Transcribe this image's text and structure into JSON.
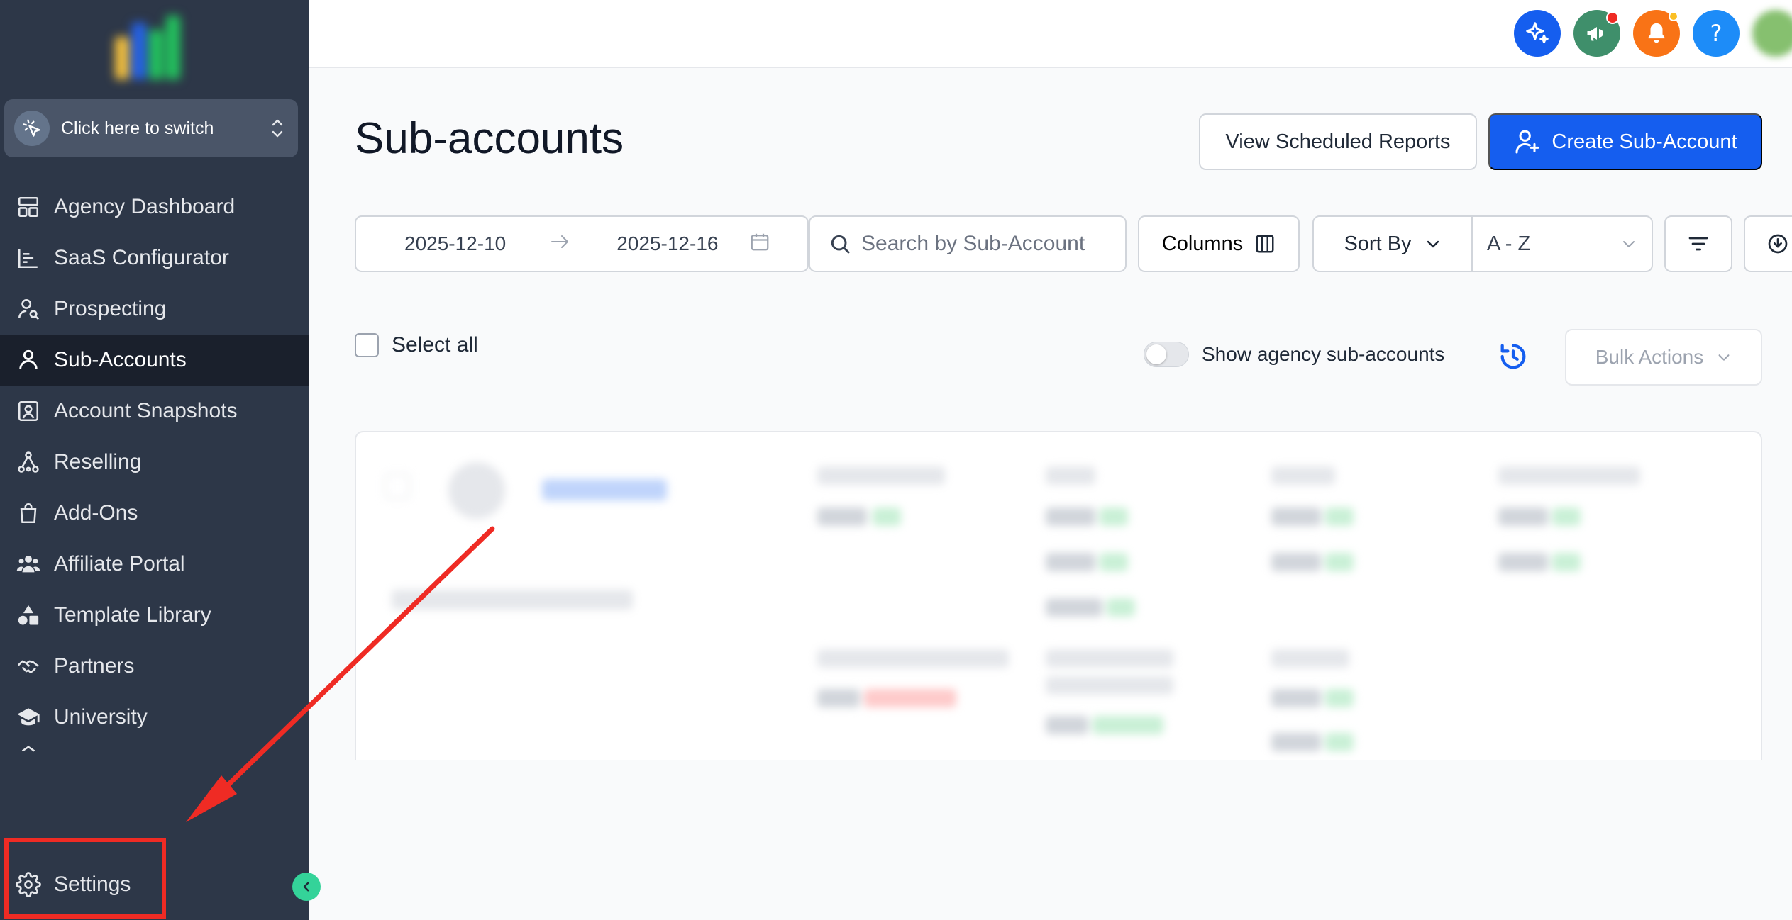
{
  "sidebar": {
    "switcher_label": "Click here to switch",
    "items": [
      {
        "label": "Agency Dashboard",
        "icon": "dashboard-icon"
      },
      {
        "label": "SaaS Configurator",
        "icon": "chart-icon"
      },
      {
        "label": "Prospecting",
        "icon": "user-search-icon"
      },
      {
        "label": "Sub-Accounts",
        "icon": "user-icon",
        "active": true
      },
      {
        "label": "Account Snapshots",
        "icon": "portrait-icon"
      },
      {
        "label": "Reselling",
        "icon": "network-icon"
      },
      {
        "label": "Add-Ons",
        "icon": "bag-icon"
      },
      {
        "label": "Affiliate Portal",
        "icon": "users-icon"
      },
      {
        "label": "Template Library",
        "icon": "shapes-icon"
      },
      {
        "label": "Partners",
        "icon": "handshake-icon"
      },
      {
        "label": "University",
        "icon": "graduation-cap-icon"
      }
    ],
    "settings_label": "Settings"
  },
  "topbar": {
    "icons": [
      {
        "name": "ai-sparkle-icon",
        "color": "#155eef"
      },
      {
        "name": "megaphone-icon",
        "color": "#3f8f6b",
        "badge": "#ef2b24"
      },
      {
        "name": "bell-icon",
        "color": "#f97316",
        "badge": "#fbbf24"
      },
      {
        "name": "help-icon",
        "color": "#1d8cf8",
        "text": "?"
      }
    ]
  },
  "page": {
    "title": "Sub-accounts",
    "view_reports_label": "View Scheduled Reports",
    "create_label": "Create Sub-Account"
  },
  "filters": {
    "date_start": "2025-12-10",
    "date_end": "2025-12-16",
    "search_placeholder": "Search by Sub-Account",
    "columns_label": "Columns",
    "sort_by_label": "Sort By",
    "sort_value": "A - Z"
  },
  "list": {
    "select_all_label": "Select all",
    "show_agency_label": "Show agency sub-accounts",
    "bulk_actions_label": "Bulk Actions"
  },
  "colors": {
    "sidebar_bg": "#2d3748",
    "primary": "#155eef",
    "annotation": "#ef2b24",
    "collapse": "#34d399"
  }
}
